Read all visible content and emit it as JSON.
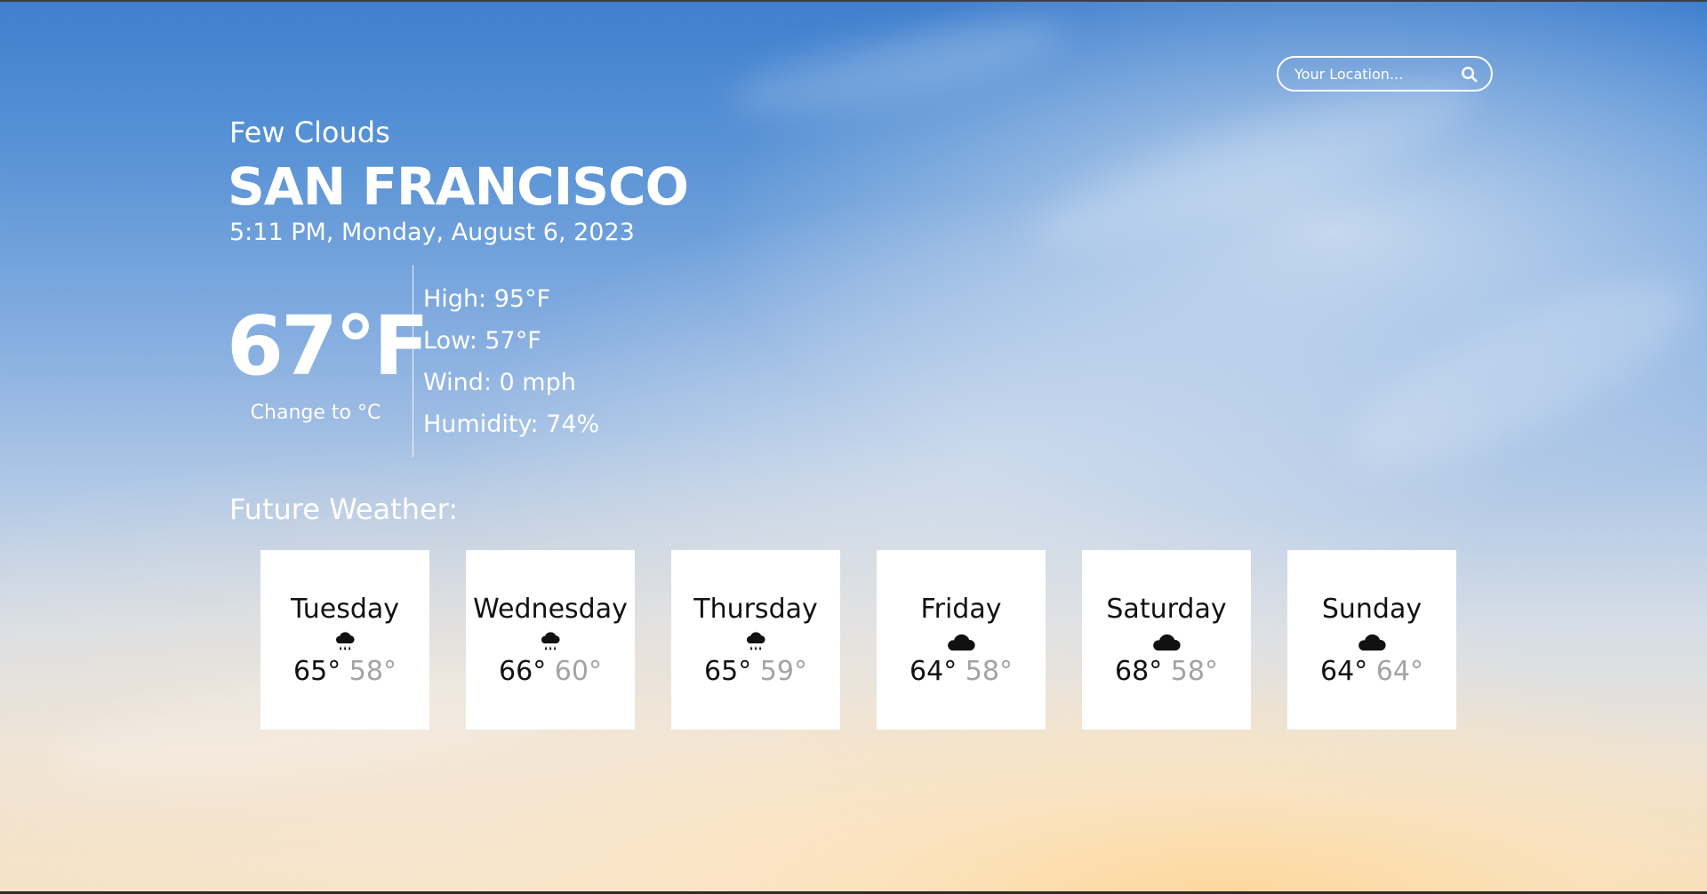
{
  "search": {
    "placeholder": "Your Location...",
    "icon": "search-icon"
  },
  "current": {
    "condition": "Few Clouds",
    "city": "SAN FRANCISCO",
    "datetime": "5:11 PM, Monday, August 6, 2023",
    "temperature": "67°F",
    "unit_toggle": "Change to °C",
    "details": [
      "High: 95°F",
      "Low: 57°F",
      "Wind: 0 mph",
      "Humidity: 74%"
    ]
  },
  "future": {
    "title": "Future Weather:",
    "days": [
      {
        "day": "Tuesday",
        "icon": "rain-cloud-icon",
        "high": "65°",
        "low": "58°"
      },
      {
        "day": "Wednesday",
        "icon": "rain-cloud-icon",
        "high": "66°",
        "low": "60°"
      },
      {
        "day": "Thursday",
        "icon": "rain-cloud-icon",
        "high": "65°",
        "low": "59°"
      },
      {
        "day": "Friday",
        "icon": "cloud-icon",
        "high": "64°",
        "low": "58°"
      },
      {
        "day": "Saturday",
        "icon": "cloud-icon",
        "high": "68°",
        "low": "58°"
      },
      {
        "day": "Sunday",
        "icon": "cloud-icon",
        "high": "64°",
        "low": "64°"
      }
    ]
  },
  "colors": {
    "text": "#ffffff",
    "card_background": "#ffffff",
    "card_text": "#111111",
    "low_temp": "#a3a3a3",
    "sky_top": "#3f7fce",
    "sky_bottom": "#f4dfc0"
  }
}
